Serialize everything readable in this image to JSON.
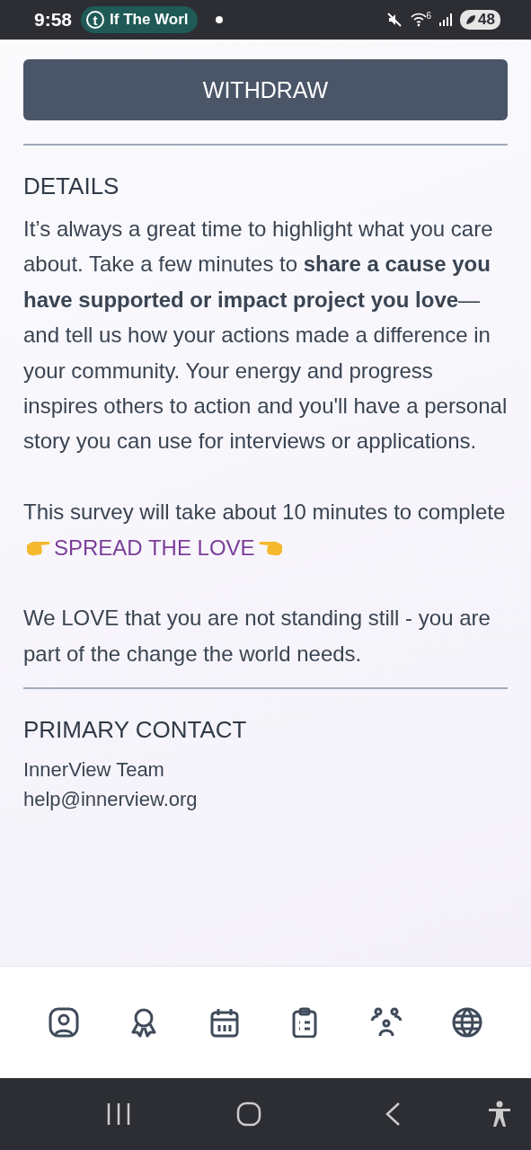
{
  "status_bar": {
    "time": "9:58",
    "notification_logo": "t",
    "notification_text": "If The Worl",
    "wifi_label": "6",
    "battery": "48"
  },
  "withdraw_button": "WITHDRAW",
  "details": {
    "heading": "DETAILS",
    "paragraph_1": "It’s always a great time to highlight what you care about. Take a few minutes to **share a cause you have supported or impact project you love**—and tell us how your actions made a difference in your community. Your energy and progress inspires others to action and you'll have a personal story you can use for interviews or applications.",
    "paragraph_2": "This survey will take about 10 minutes to complete",
    "highlight": "SPREAD THE LOVE",
    "paragraph_3": "We LOVE that you are not standing still - you are part of the change the world needs."
  },
  "primary_contact": {
    "heading": "PRIMARY CONTACT",
    "name": "InnerView Team",
    "email": "help@innerview.org"
  }
}
